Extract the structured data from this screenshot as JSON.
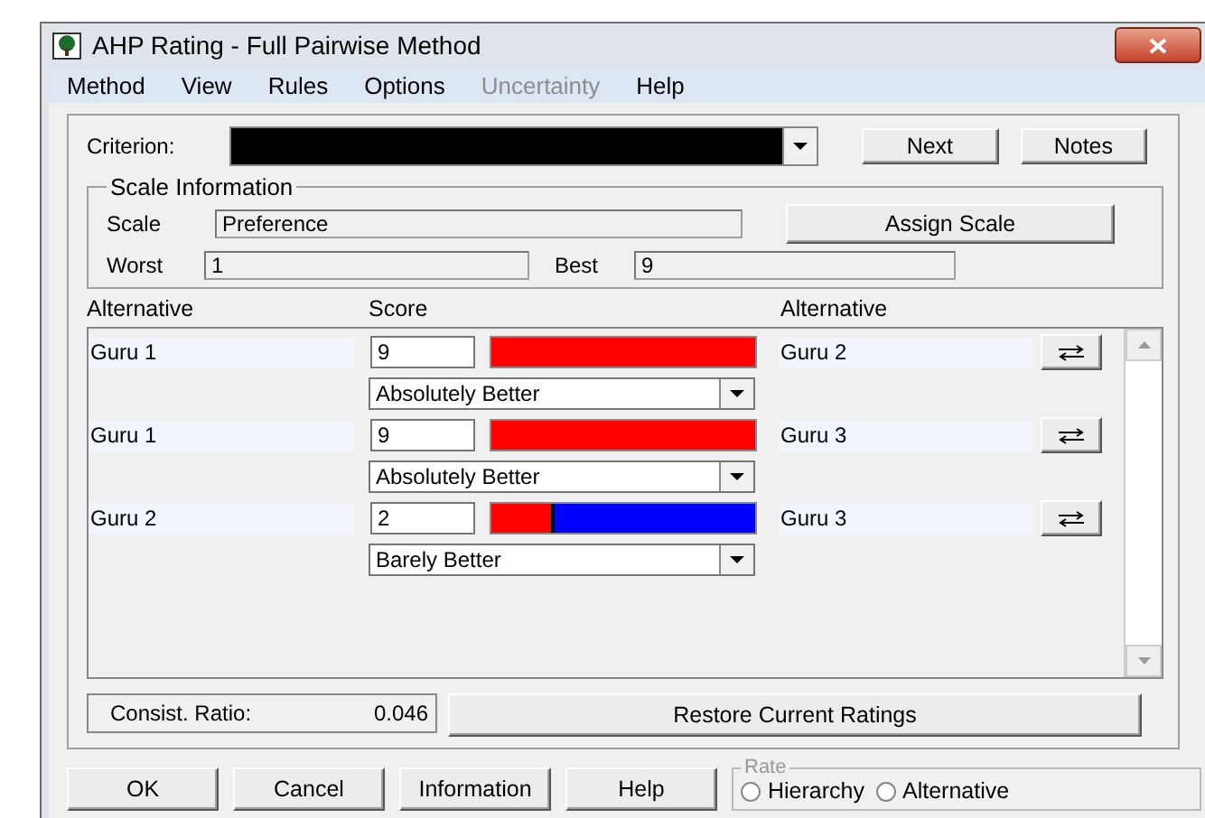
{
  "window": {
    "title": "AHP Rating - Full Pairwise Method"
  },
  "menu": [
    {
      "label": "Method",
      "disabled": false
    },
    {
      "label": "View",
      "disabled": false
    },
    {
      "label": "Rules",
      "disabled": false
    },
    {
      "label": "Options",
      "disabled": false
    },
    {
      "label": "Uncertainty",
      "disabled": true
    },
    {
      "label": "Help",
      "disabled": false
    }
  ],
  "criterion": {
    "label": "Criterion:"
  },
  "top_buttons": [
    "Next",
    "Notes"
  ],
  "scale_information": {
    "title": "Scale Information",
    "scale_label": "Scale",
    "scale_value": "Preference",
    "assign_button": "Assign Scale",
    "worst_label": "Worst",
    "worst_value": "1",
    "best_label": "Best",
    "best_value": "9"
  },
  "columns": [
    "Alternative",
    "Score",
    "Alternative"
  ],
  "comparisons": [
    {
      "left": "Guru 1",
      "score": "9",
      "level": 1,
      "verbal": "Absolutely Better",
      "right": "Guru 2"
    },
    {
      "left": "Guru 1",
      "score": "9",
      "level": 1,
      "verbal": "Absolutely Better",
      "right": "Guru 3"
    },
    {
      "left": "Guru 2",
      "score": "2",
      "level": 0.24,
      "verbal": "Barely Better",
      "right": "Guru 3"
    }
  ],
  "consistency": {
    "label": "Consist. Ratio:",
    "value": "0.046"
  },
  "restore_button": "Restore Current Ratings",
  "buttons": [
    "OK",
    "Cancel",
    "Information",
    "Help"
  ],
  "rate": {
    "title": "Rate",
    "options": [
      {
        "label": "Hierarchy",
        "selected": false
      },
      {
        "label": "Alternative",
        "selected": false
      }
    ]
  }
}
